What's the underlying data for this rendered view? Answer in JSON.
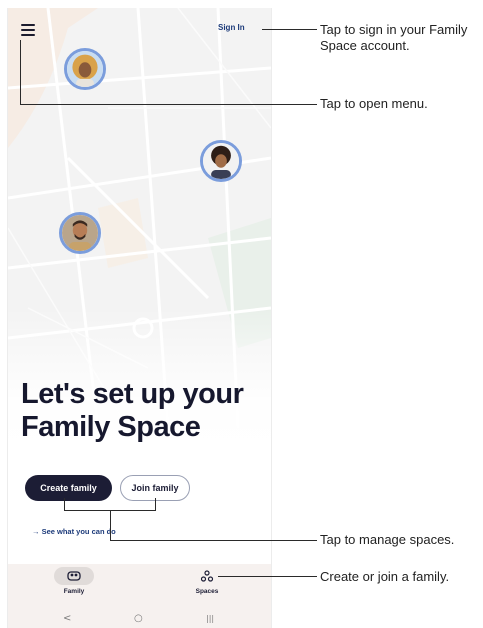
{
  "header": {
    "menu_icon": "hamburger-menu-icon",
    "signin_label": "Sign In"
  },
  "main": {
    "headline": "Let's set up your Family Space",
    "create_label": "Create family",
    "join_label": "Join family",
    "see_link": "→ See what you can do"
  },
  "bottom_nav": {
    "items": [
      {
        "label": "Family",
        "icon": "family-icon"
      },
      {
        "label": "Spaces",
        "icon": "spaces-icon"
      }
    ]
  },
  "system_nav": {
    "back": "<",
    "home": "○",
    "recents": "|||"
  },
  "callouts": {
    "signin": "Tap to sign in your Family Space account.",
    "menu": "Tap to open menu.",
    "manage": "Tap to manage spaces.",
    "create": "Create or join a family."
  },
  "colors": {
    "navy": "#1c1d35",
    "link_blue": "#1d3b7a",
    "avatar_ring": "#7b9ddc",
    "nav_bg": "#f6f1ef"
  }
}
